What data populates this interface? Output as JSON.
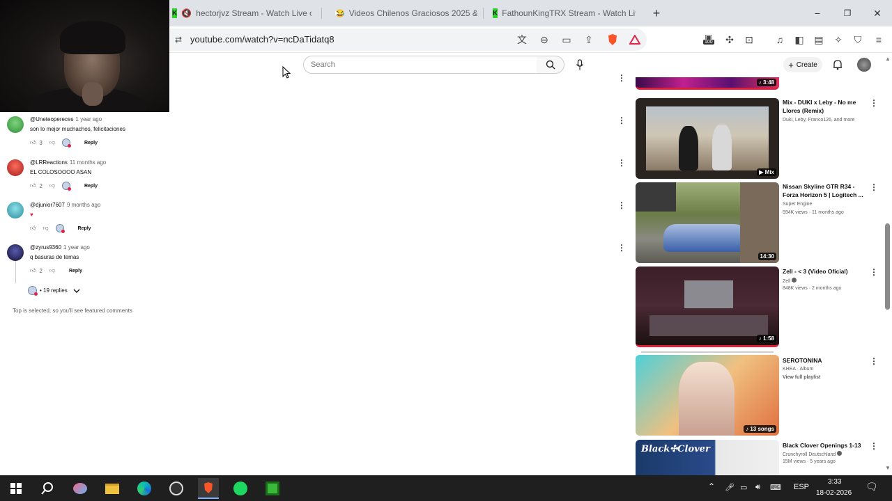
{
  "tabs": [
    {
      "title": "hectorjvz Stream - Watch Live on",
      "icon": "kick-icon"
    },
    {
      "title": "Videos Chilenos Graciosos 2025 &",
      "icon": "youtube-icon"
    },
    {
      "title": "FathounKingTRX Stream - Watch Live",
      "icon": "kick-icon"
    }
  ],
  "window": {
    "new_tab": "+",
    "minimize": "−",
    "restore": "❐",
    "close": "✕"
  },
  "address_bar": {
    "url": "youtube.com/watch?v=ncDaTidatq8",
    "shield_count": "99+",
    "extension_badge": "100"
  },
  "masthead": {
    "search_placeholder": "Search",
    "create_label": "Create"
  },
  "comments": [
    {
      "author": "@Uneteopereces",
      "time": "1 year ago",
      "text": "son lo mejor muchachos, felicitaciones",
      "likes": "3",
      "reply": "Reply",
      "avatar_color": "#3aa64a"
    },
    {
      "author": "@LRReactions",
      "time": "11 months ago",
      "text": "EL COLOSOOOO ASAN",
      "likes": "2",
      "reply": "Reply",
      "avatar_color": "#c8302a"
    },
    {
      "author": "@djunior7607",
      "time": "9 months ago",
      "text": "♥",
      "likes": "",
      "reply": "Reply",
      "avatar_color": "#4cb8c8"
    },
    {
      "author": "@zyrus9360",
      "time": "1 year ago",
      "text": "q basuras de temas",
      "likes": "2",
      "reply": "Reply",
      "avatar_color": "#1e1e5a"
    }
  ],
  "replies_toggle": "• 19 replies",
  "comments_footer": "Top is selected, so you'll see featured comments",
  "videos": [
    {
      "duration": "♪ 3:48",
      "title": "",
      "channel": "",
      "meta": ""
    },
    {
      "duration": "▶ Mix",
      "title": "Mix - DUKI x Leby - No me Llores (Remix)",
      "channel": "Duki, Leby, Franco126, and more",
      "meta": ""
    },
    {
      "duration": "14:30",
      "title": "Nissan Skyline GTR R34 - Forza Horizon 5 | Logitech ...",
      "channel": "Super Engine",
      "meta": "594K views · 11 months ago"
    },
    {
      "duration": "♪ 1:58",
      "title": "Zell - < 3 (Video Oficial)",
      "channel": "Zell",
      "meta": "848K views · 2 months ago"
    },
    {
      "duration": "♪ 13 songs",
      "title": "SEROTONINA",
      "channel": "KHEA · Album",
      "meta": "View full playlist"
    },
    {
      "duration": "",
      "title": "Black Clover Openings 1-13",
      "channel": "Crunchyroll Deutschland",
      "meta": "15M views · 5 years ago",
      "thumb_text": "Black✣Clover"
    }
  ],
  "taskbar": {
    "language": "ESP",
    "time": "3:33",
    "date": "18-02-2026"
  },
  "colors": {
    "youtube_red": "#ff0000",
    "kick_green": "#2fd12f",
    "brave_orange": "#fb542b",
    "taskbar": "#1f1f1f"
  }
}
